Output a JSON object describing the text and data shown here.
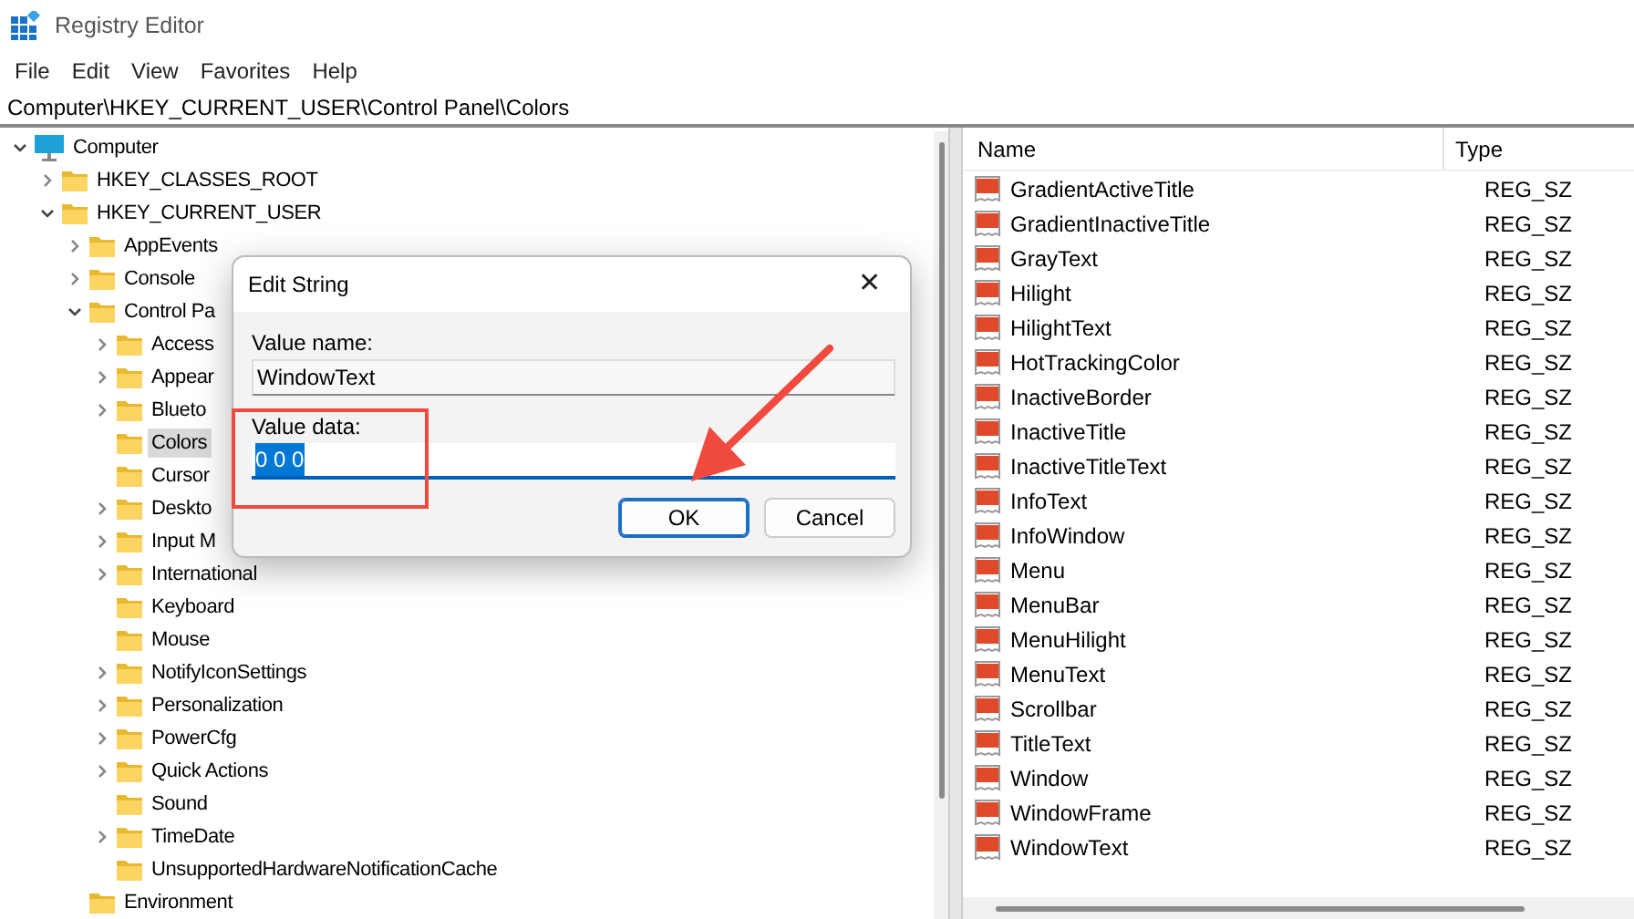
{
  "window": {
    "title": "Registry Editor"
  },
  "menu": [
    "File",
    "Edit",
    "View",
    "Favorites",
    "Help"
  ],
  "address": "Computer\\HKEY_CURRENT_USER\\Control Panel\\Colors",
  "tree": [
    {
      "label": "Computer",
      "kind": "computer",
      "expanded": true,
      "selected": false,
      "children": [
        {
          "label": "HKEY_CLASSES_ROOT",
          "expanded": false,
          "selected": false
        },
        {
          "label": "HKEY_CURRENT_USER",
          "expanded": true,
          "selected": false,
          "children": [
            {
              "label": "AppEvents",
              "expanded": false,
              "selected": false
            },
            {
              "label": "Console",
              "expanded": false,
              "selected": false
            },
            {
              "label": "Control Pa",
              "expanded": true,
              "selected": false,
              "children": [
                {
                  "label": "Access",
                  "expanded": false,
                  "selected": false
                },
                {
                  "label": "Appear",
                  "expanded": false,
                  "selected": false
                },
                {
                  "label": "Blueto",
                  "expanded": false,
                  "selected": false
                },
                {
                  "label": "Colors",
                  "selected": true
                },
                {
                  "label": "Cursor",
                  "selected": false
                },
                {
                  "label": "Deskto",
                  "expanded": false,
                  "selected": false
                },
                {
                  "label": "Input M",
                  "expanded": false,
                  "selected": false
                },
                {
                  "label": "International",
                  "expanded": false,
                  "selected": false
                },
                {
                  "label": "Keyboard",
                  "selected": false
                },
                {
                  "label": "Mouse",
                  "selected": false
                },
                {
                  "label": "NotifyIconSettings",
                  "expanded": false,
                  "selected": false
                },
                {
                  "label": "Personalization",
                  "expanded": false,
                  "selected": false
                },
                {
                  "label": "PowerCfg",
                  "expanded": false,
                  "selected": false
                },
                {
                  "label": "Quick Actions",
                  "expanded": false,
                  "selected": false
                },
                {
                  "label": "Sound",
                  "selected": false
                },
                {
                  "label": "TimeDate",
                  "expanded": false,
                  "selected": false
                },
                {
                  "label": "UnsupportedHardwareNotificationCache",
                  "selected": false
                }
              ]
            },
            {
              "label": "Environment",
              "selected": false
            }
          ]
        }
      ]
    }
  ],
  "values": {
    "columns": [
      "Name",
      "Type"
    ],
    "rows": [
      {
        "name": "GradientActiveTitle",
        "type": "REG_SZ"
      },
      {
        "name": "GradientInactiveTitle",
        "type": "REG_SZ"
      },
      {
        "name": "GrayText",
        "type": "REG_SZ"
      },
      {
        "name": "Hilight",
        "type": "REG_SZ"
      },
      {
        "name": "HilightText",
        "type": "REG_SZ"
      },
      {
        "name": "HotTrackingColor",
        "type": "REG_SZ"
      },
      {
        "name": "InactiveBorder",
        "type": "REG_SZ"
      },
      {
        "name": "InactiveTitle",
        "type": "REG_SZ"
      },
      {
        "name": "InactiveTitleText",
        "type": "REG_SZ"
      },
      {
        "name": "InfoText",
        "type": "REG_SZ"
      },
      {
        "name": "InfoWindow",
        "type": "REG_SZ"
      },
      {
        "name": "Menu",
        "type": "REG_SZ"
      },
      {
        "name": "MenuBar",
        "type": "REG_SZ"
      },
      {
        "name": "MenuHilight",
        "type": "REG_SZ"
      },
      {
        "name": "MenuText",
        "type": "REG_SZ"
      },
      {
        "name": "Scrollbar",
        "type": "REG_SZ"
      },
      {
        "name": "TitleText",
        "type": "REG_SZ"
      },
      {
        "name": "Window",
        "type": "REG_SZ"
      },
      {
        "name": "WindowFrame",
        "type": "REG_SZ"
      },
      {
        "name": "WindowText",
        "type": "REG_SZ"
      }
    ]
  },
  "dialog": {
    "title": "Edit String",
    "close": "✕",
    "value_name_label": "Value name:",
    "value_name": "WindowText",
    "value_data_label": "Value data:",
    "value_data": "0 0 0",
    "buttons": [
      {
        "label": "OK",
        "default": true
      },
      {
        "label": "Cancel",
        "default": false
      }
    ]
  },
  "callouts": {
    "highlight_box": true,
    "arrow": true
  }
}
